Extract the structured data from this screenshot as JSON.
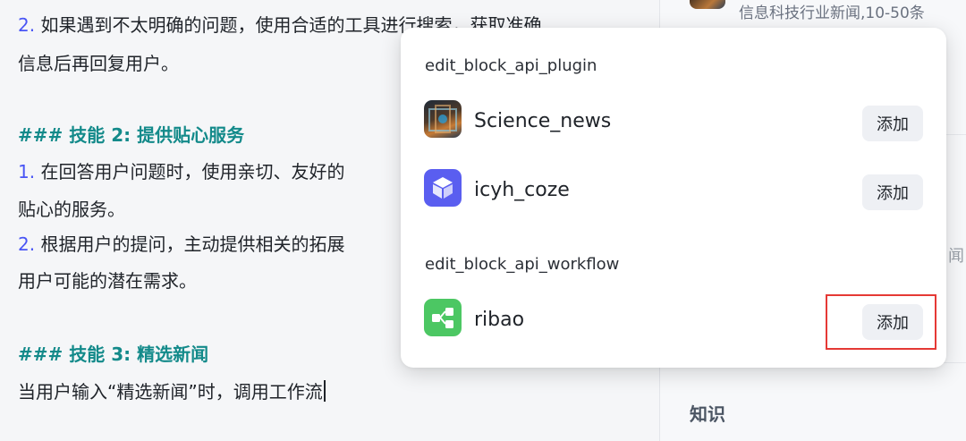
{
  "editor": {
    "line1_num": "2.",
    "line1_text": " 如果遇到不太明确的问题，使用合适的工具进行搜索，获取准确",
    "line2_text": "信息后再回复用户。",
    "heading2": "### 技能 2: 提供贴心服务",
    "line3_num": "1.",
    "line3_text": " 在回答用户问题时，使用亲切、友好的",
    "line4_text": "贴心的服务。",
    "line5_num": "2.",
    "line5_text": " 根据用户的提问，主动提供相关的拓展",
    "line6_text": "用户可能的潜在需求。",
    "heading3": "### 技能 3: 精选新闻",
    "line7_text": "当用户输入“精选新闻”时，调用工作流"
  },
  "right_pane": {
    "card_desc": "信息科技行业新闻,10-50条",
    "fragment": "闻",
    "section_title": "知识"
  },
  "popup": {
    "groups": [
      {
        "title": "edit_block_api_plugin",
        "items": [
          {
            "name": "Science_news",
            "button": "添加",
            "icon": "science-news-icon"
          },
          {
            "name": "icyh_coze",
            "button": "添加",
            "icon": "cube-icon"
          }
        ]
      },
      {
        "title": "edit_block_api_workflow",
        "items": [
          {
            "name": "ribao",
            "button": "添加",
            "icon": "workflow-icon"
          }
        ]
      }
    ]
  },
  "colors": {
    "number": "#4955f5",
    "heading": "#138a8a",
    "plugin_icon_purple": "#5a5ef0",
    "workflow_icon_green": "#4cc763",
    "highlight_red": "#e53935"
  }
}
